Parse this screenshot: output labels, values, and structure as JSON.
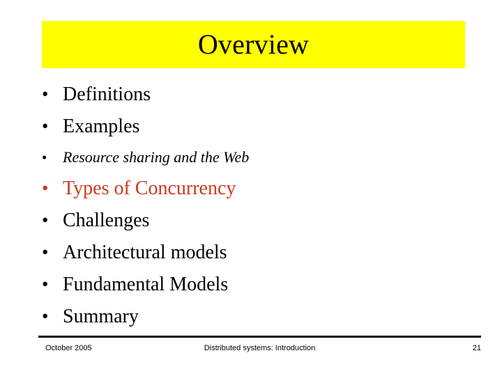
{
  "slide": {
    "title": "Overview",
    "title_banner_color": "#ffff00",
    "accent_color": "#cc3a1e",
    "text_color": "#000000",
    "background_color": "#ffffff",
    "bullet_glyph": "•",
    "bullets": [
      {
        "label": "Definitions",
        "emphasis": "normal",
        "size": "large"
      },
      {
        "label": "Examples",
        "emphasis": "normal",
        "size": "large"
      },
      {
        "label": "Resource sharing and the Web",
        "emphasis": "italic",
        "size": "small"
      },
      {
        "label": "Types of Concurrency",
        "emphasis": "accent",
        "size": "large"
      },
      {
        "label": "Challenges",
        "emphasis": "normal",
        "size": "large"
      },
      {
        "label": "Architectural models",
        "emphasis": "normal",
        "size": "large"
      },
      {
        "label": "Fundamental Models",
        "emphasis": "normal",
        "size": "large"
      },
      {
        "label": "Summary",
        "emphasis": "normal",
        "size": "large"
      }
    ]
  },
  "footer": {
    "date": "October 2005",
    "subject": "Distributed systems: Introduction",
    "page_number": "21"
  }
}
